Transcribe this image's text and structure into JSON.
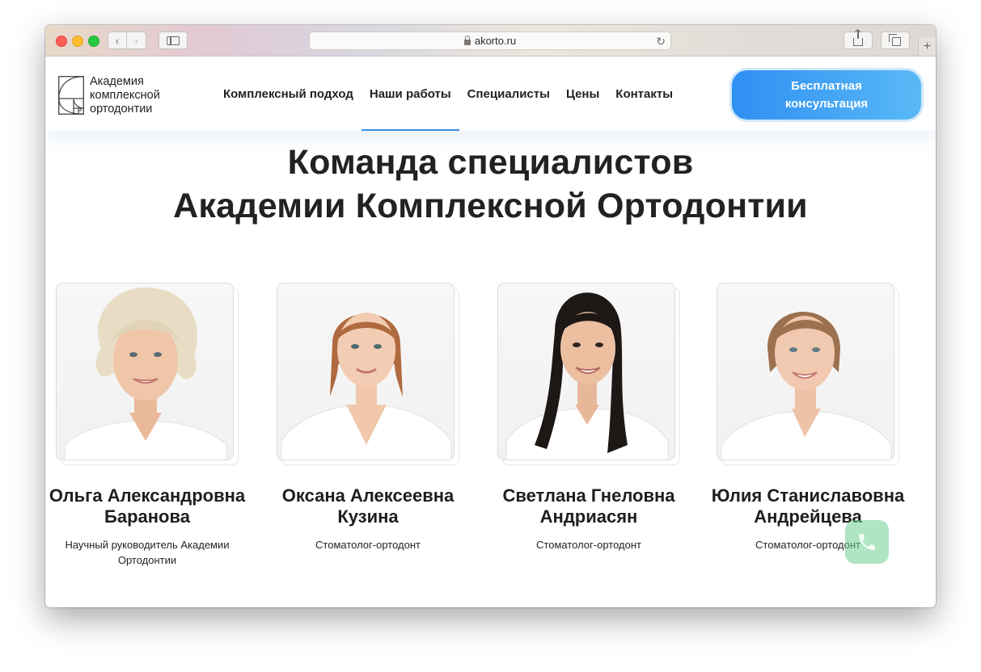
{
  "browser": {
    "url": "akorto.ru"
  },
  "site": {
    "logo_lines": [
      "Академия",
      "комплексной",
      "ортодонтии"
    ],
    "nav": [
      {
        "label": "Комплексный подход",
        "active": false
      },
      {
        "label": "Наши работы",
        "active": true
      },
      {
        "label": "Специалисты",
        "active": false
      },
      {
        "label": "Цены",
        "active": false
      },
      {
        "label": "Контакты",
        "active": false
      }
    ],
    "cta_label": "Бесплатная консультация",
    "accent_color": "#2f8ff3"
  },
  "section": {
    "title_line1": "Команда специалистов",
    "title_line2": "Академии Комплексной Ортодонтии"
  },
  "team": [
    {
      "name": "Ольга Александровна Баранова",
      "role": "Научный руководитель Академии Ортодонтии"
    },
    {
      "name": "Оксана Алексеевна Кузина",
      "role": "Стоматолог-ортодонт"
    },
    {
      "name": "Светлана Гнеловна Андриасян",
      "role": "Стоматолог-ортодонт"
    },
    {
      "name": "Юлия Станиславовна Андрейцева",
      "role": "Стоматолог-ортодонт"
    }
  ]
}
